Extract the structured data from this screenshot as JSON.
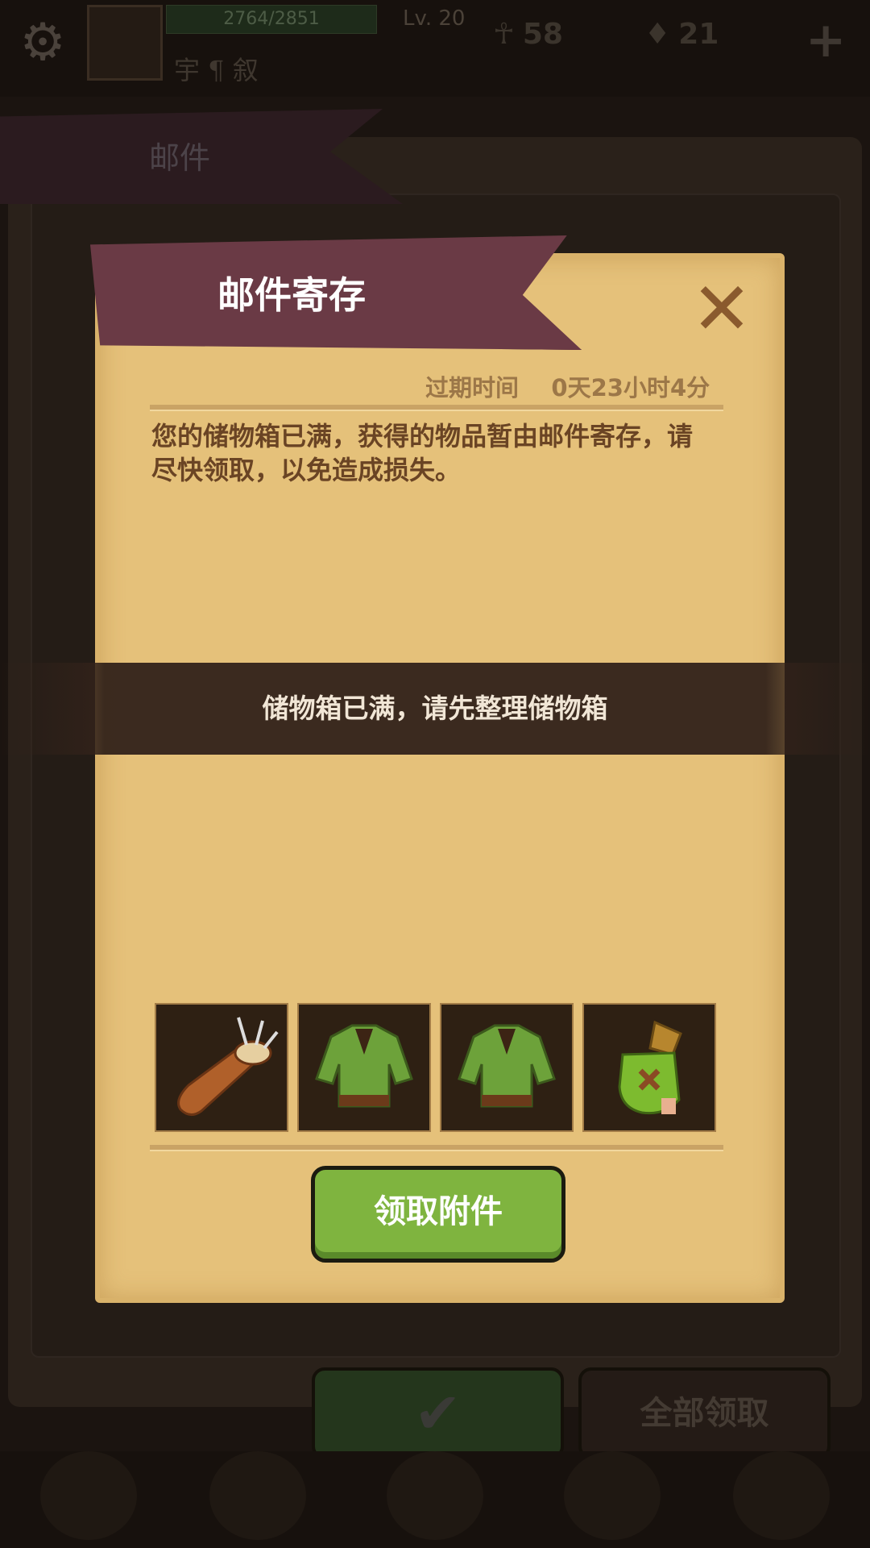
{
  "hud": {
    "xp": "2764/2851",
    "level": "Lv. 20",
    "player_name": "宇 ¶ 叙",
    "resources": [
      {
        "icon": "ankh-icon",
        "value": "58"
      },
      {
        "icon": "gem-icon",
        "value": "21"
      }
    ]
  },
  "background": {
    "tab_label": "邮件",
    "claim_all_label": "全部领取"
  },
  "modal": {
    "title": "邮件寄存",
    "expire_label": "过期时间",
    "expire_value": "0天23小时4分",
    "body": "您的储物箱已满，获得的物品暂由邮件寄存，请尽快领取，以免造成损失。",
    "attachments": [
      {
        "icon": "arrow-quiver-icon"
      },
      {
        "icon": "green-tunic-icon"
      },
      {
        "icon": "green-tunic-icon"
      },
      {
        "icon": "green-glove-icon"
      }
    ],
    "claim_button": "领取附件"
  },
  "toast": "储物箱已满，请先整理储物箱",
  "colors": {
    "parchment": "#e5c17a",
    "banner": "#6a3a45",
    "claim_button": "#7fb43f",
    "body_text": "#6a4424"
  }
}
